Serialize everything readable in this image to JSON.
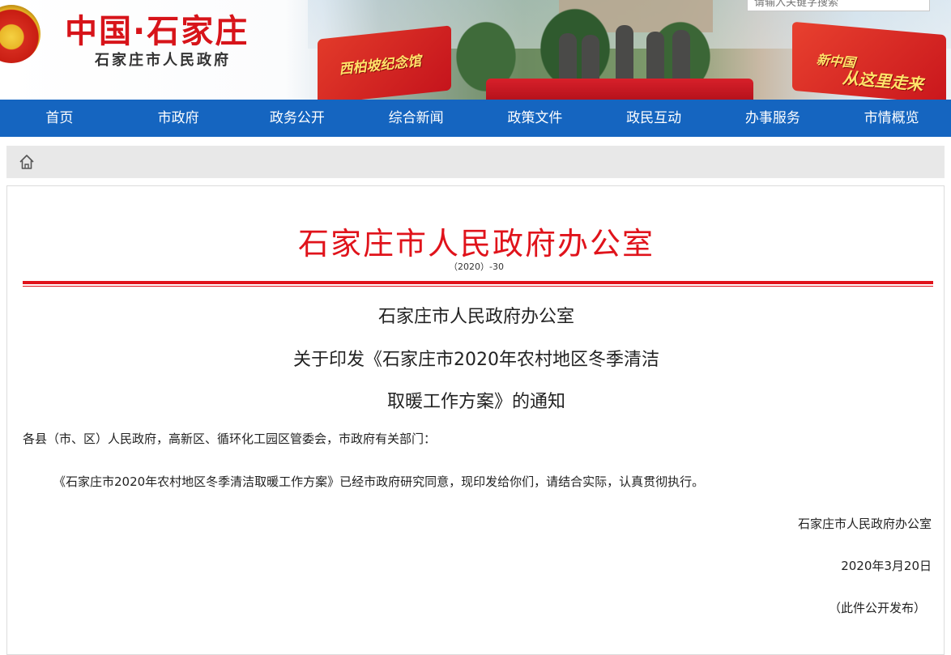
{
  "banner": {
    "site_title": "中国·石家庄",
    "site_subtitle": "石家庄市人民政府",
    "search_placeholder": "请输入关键字搜索",
    "flag_left_text": "西柏坡纪念馆",
    "flag_right_line1": "新中国",
    "flag_right_line2": "从这里走来"
  },
  "nav": {
    "items": [
      "首页",
      "市政府",
      "政务公开",
      "综合新闻",
      "政策文件",
      "政民互动",
      "办事服务",
      "市情概览"
    ]
  },
  "document": {
    "issuing_org_header": "石家庄市人民政府办公室",
    "doc_number": "（2020）-30",
    "title_line1": "石家庄市人民政府办公室",
    "title_line2": "关于印发《石家庄市2020年农村地区冬季清洁",
    "title_line3": "取暖工作方案》的通知",
    "salutation": "各县（市、区）人民政府，高新区、循环化工园区管委会，市政府有关部门：",
    "body": "《石家庄市2020年农村地区冬季清洁取暖工作方案》已经市政府研究同意，现印发给你们，请结合实际，认真贯彻执行。",
    "signature_org": "石家庄市人民政府办公室",
    "signature_date": "2020年3月20日",
    "public_note": "（此件公开发布）"
  },
  "colors": {
    "nav_bg": "#1565c0",
    "header_red": "#e0131b",
    "breadcrumb_bg": "#e8e8e8"
  },
  "icons": {
    "emblem": "national-emblem",
    "home": "home-icon"
  }
}
